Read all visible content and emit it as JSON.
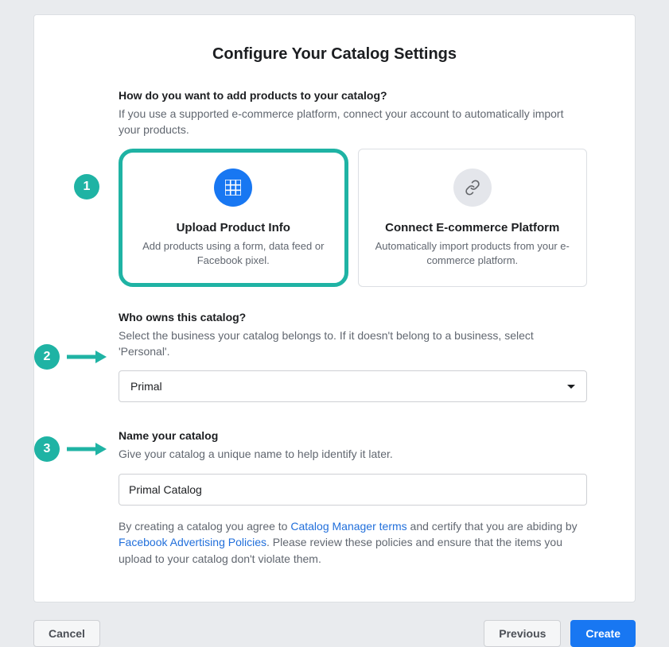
{
  "title": "Configure Your Catalog Settings",
  "section1": {
    "label": "How do you want to add products to your catalog?",
    "subtext": "If you use a supported e-commerce platform, connect your account to automatically import your products."
  },
  "options": {
    "upload": {
      "title": "Upload Product Info",
      "desc": "Add products using a form, data feed or Facebook pixel."
    },
    "connect": {
      "title": "Connect E-commerce Platform",
      "desc": "Automatically import products from your e-commerce platform."
    }
  },
  "section2": {
    "label": "Who owns this catalog?",
    "subtext": "Select the business your catalog belongs to. If it doesn't belong to a business, select 'Personal'.",
    "value": "Primal"
  },
  "section3": {
    "label": "Name your catalog",
    "subtext": "Give your catalog a unique name to help identify it later.",
    "value": "Primal Catalog"
  },
  "terms": {
    "prefix": "By creating a catalog you agree to ",
    "link1": "Catalog Manager terms",
    "mid": " and certify that you are abiding by ",
    "link2": "Facebook Advertising Policies",
    "suffix": ". Please review these policies and ensure that the items you upload to your catalog don't violate them."
  },
  "buttons": {
    "cancel": "Cancel",
    "previous": "Previous",
    "create": "Create"
  },
  "badges": {
    "one": "1",
    "two": "2",
    "three": "3"
  },
  "colors": {
    "accent_teal": "#1fb3a4",
    "primary_blue": "#1877f2",
    "link_blue": "#216fdb"
  }
}
